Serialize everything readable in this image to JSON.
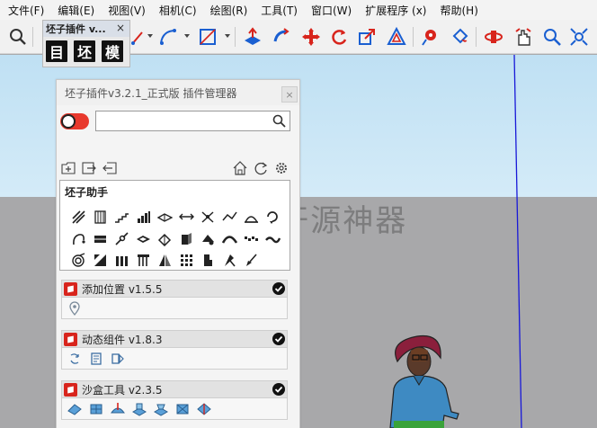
{
  "menu": [
    "文件(F)",
    "编辑(E)",
    "视图(V)",
    "相机(C)",
    "绘图(R)",
    "工具(T)",
    "窗口(W)",
    "扩展程序 (x)",
    "帮助(H)"
  ],
  "toolbar_icons": [
    "zoom-icon",
    "pencil-tool-icon",
    "arc-tool-icon",
    "rectangle-tool-icon",
    "push-pull-icon",
    "follow-me-icon",
    "move-icon",
    "rotate-icon",
    "scale-icon",
    "offset-icon",
    "tape-measure-icon",
    "paint-bucket-icon",
    "orbit-icon",
    "pan-icon",
    "zoom-tool-icon",
    "zoom-extents-icon"
  ],
  "mini_toolbar": {
    "title": "坯子插件 v...",
    "close": "×",
    "buttons": [
      "目",
      "坯",
      "模"
    ]
  },
  "watermark": "公众号: 开源神器",
  "panel": {
    "title": "坯子插件v3.2.1_正式版 插件管理器",
    "close": "×",
    "search_placeholder": "",
    "actions_left": [
      "add-plugin-icon",
      "export-icon",
      "import-icon"
    ],
    "actions_right": [
      "home-icon",
      "refresh-icon",
      "settings-icon"
    ],
    "helper": {
      "title": "坯子助手",
      "tools": 30
    },
    "plugins": [
      {
        "name": "添加位置 v1.5.5",
        "tools": [
          "location-pin-icon"
        ]
      },
      {
        "name": "动态组件 v1.8.3",
        "tools": [
          "interact-icon",
          "component-options-icon",
          "component-attributes-icon"
        ]
      },
      {
        "name": "沙盒工具 v2.3.5",
        "tools": [
          "from-contours-icon",
          "from-scratch-icon",
          "smoove-icon",
          "stamp-icon",
          "drape-icon",
          "add-detail-icon",
          "flip-edge-icon"
        ]
      }
    ]
  },
  "colors": {
    "accent_red": "#d8241c",
    "axis_blue": "#1818d8",
    "sky": "#c7e4f5",
    "ground": "#a8a8aa"
  }
}
